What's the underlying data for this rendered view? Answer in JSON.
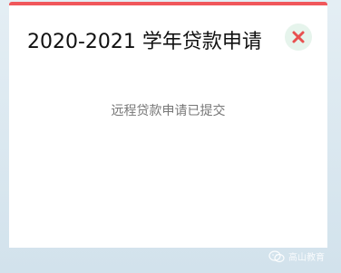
{
  "dialog": {
    "title": "2020-2021 学年贷款申请",
    "message": "远程贷款申请已提交",
    "accent_color": "#f0575b",
    "close_icon": "close-icon",
    "close_icon_color": "#e8504f",
    "close_bg_color": "#e6f4ec"
  },
  "watermark": {
    "text": "高山教育",
    "icon": "wechat-icon"
  }
}
